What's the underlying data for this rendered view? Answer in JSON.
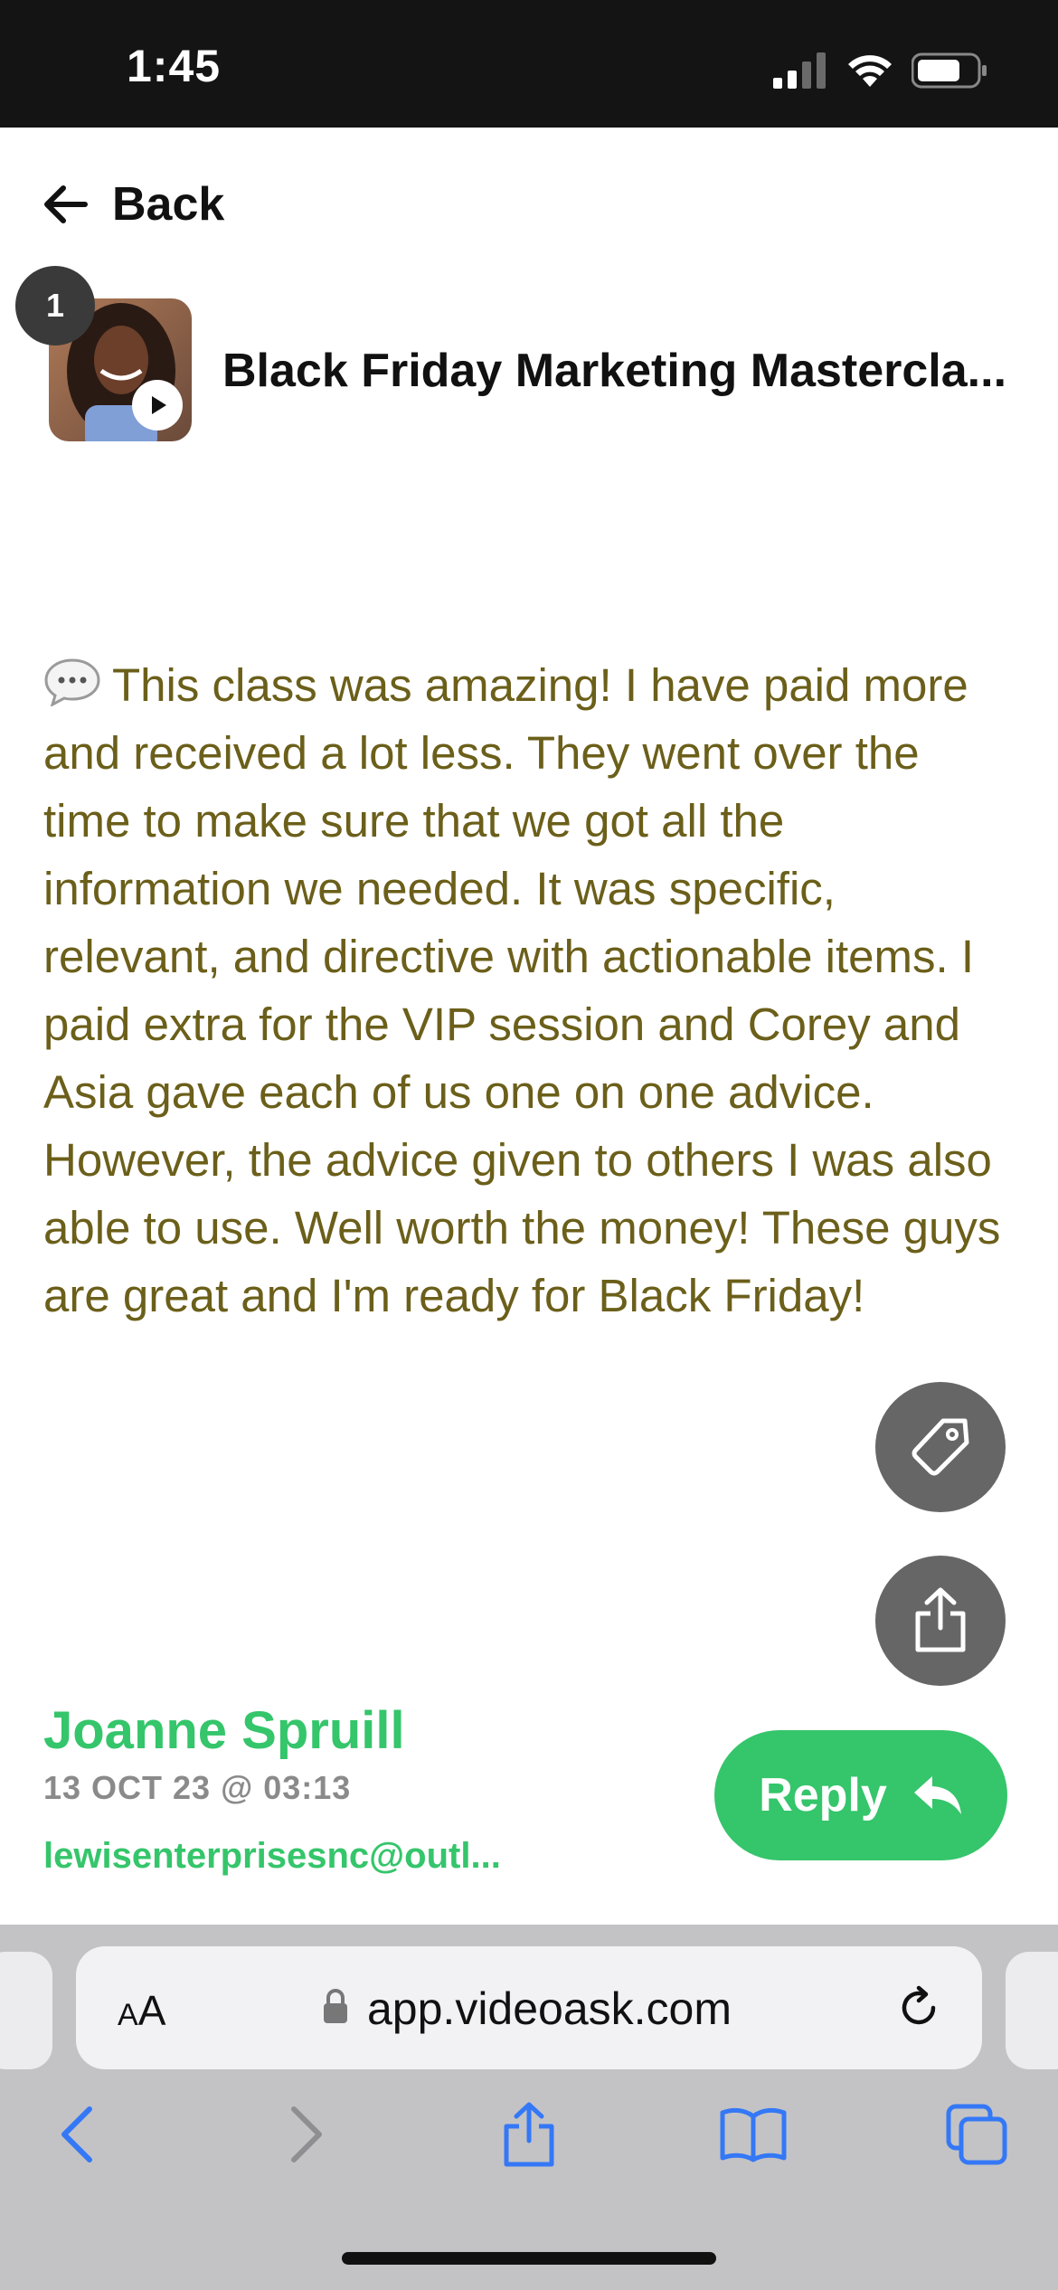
{
  "status_bar": {
    "time": "1:45"
  },
  "header": {
    "back_label": "Back",
    "thumbnail_count": "1",
    "video_title": "Black Friday Marketing Mastercla..."
  },
  "message": {
    "text": "This class was amazing! I have paid more and received a lot less. They went over the time to make sure that we got all the information we needed. It was specific, relevant, and directive with actionable items. I paid extra for the VIP session and Corey and Asia gave each of us one on one advice. However, the advice given to others I was also able to use. Well worth the money! These guys are great and I'm ready for Black Friday!"
  },
  "sender": {
    "name": "Joanne Spruill",
    "date": "13 OCT 23 @ 03:13",
    "email": "lewisenterprisesnc@outl..."
  },
  "actions": {
    "reply_label": "Reply"
  },
  "browser": {
    "text_size_label_big": "A",
    "text_size_label_small": "A",
    "url": "app.videoask.com"
  },
  "icons": {
    "back": "arrow-left-icon",
    "tag": "tag-icon",
    "share": "share-icon",
    "reply": "reply-arrow-icon",
    "play": "play-icon",
    "comment": "speech-bubble-icon",
    "lock": "lock-icon",
    "reload": "reload-icon",
    "nav_back": "chevron-left-icon",
    "nav_forward": "chevron-right-icon",
    "bookmarks": "book-icon",
    "tabs": "tabs-icon"
  },
  "colors": {
    "accent_green": "#35c56b",
    "message_text": "#6b5f1a",
    "fab_gray": "#666666",
    "safari_blue": "#3478f6"
  }
}
